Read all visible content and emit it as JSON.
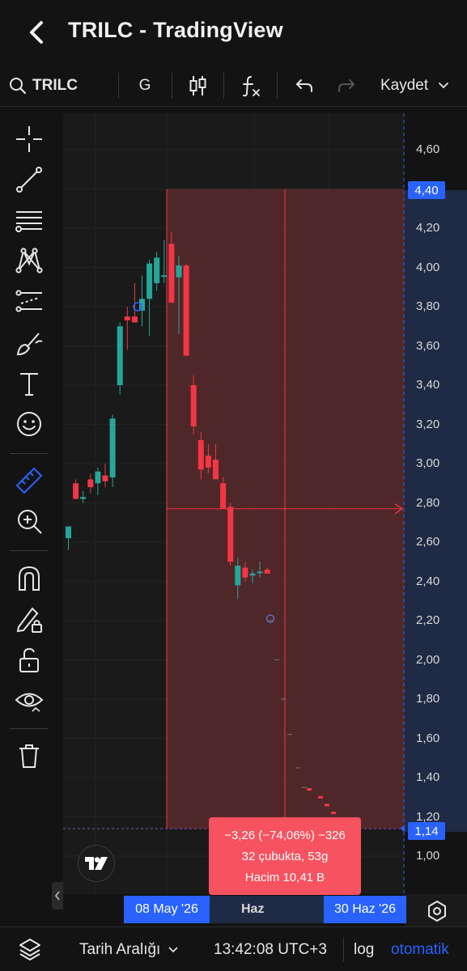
{
  "window": {
    "title": "TRILC - TradingView"
  },
  "toolbar": {
    "symbol": "TRILC",
    "interval": "G",
    "save_label": "Kaydet",
    "icons": [
      "search-icon",
      "candles-icon",
      "indicators-icon",
      "undo-icon",
      "redo-icon",
      "chevron-down-icon"
    ]
  },
  "left_tools": [
    "crosshair-icon",
    "trend-line-icon",
    "fib-icon",
    "pattern-icon",
    "prediction-icon",
    "brush-icon",
    "text-icon",
    "emoji-icon",
    "ruler-icon",
    "zoom-in-icon",
    "magnet-icon",
    "lock-drawings-icon",
    "unlock-icon",
    "eye-icon",
    "trash-icon"
  ],
  "price_scale": {
    "labels": [
      "4,60",
      "4,20",
      "4,00",
      "3,80",
      "3,60",
      "3,40",
      "3,20",
      "3,00",
      "2,80",
      "2,60",
      "2,40",
      "2,20",
      "2,00",
      "1,80",
      "1,60",
      "1,40",
      "1,20",
      "1,00"
    ],
    "top_tag": "4,40",
    "bottom_tag": "1,14"
  },
  "time_scale": {
    "start_tag": "08 May '26",
    "mid_label": "Haz",
    "end_tag": "30 Haz '26"
  },
  "measure_tooltip": {
    "line1": "−3,26 (−74,06%) −326",
    "line2": "32 çubukta, 53g",
    "line3": "Hacim 10,41 B"
  },
  "bottom_bar": {
    "date_range": "Tarih Aralığı",
    "clock": "13:42:08 UTC+3",
    "log": "log",
    "auto": "otomatik"
  },
  "colors": {
    "up": "#26a69a",
    "down": "#f23645",
    "accent": "#2962ff",
    "zone": "#5a2a2c"
  },
  "chart_data": {
    "type": "candlestick",
    "ylim": [
      1.0,
      4.6
    ],
    "candles": [
      {
        "o": 2.62,
        "h": 2.68,
        "l": 2.56,
        "c": 2.68
      },
      {
        "o": 2.9,
        "h": 2.92,
        "l": 2.82,
        "c": 2.82
      },
      {
        "o": 2.82,
        "h": 2.86,
        "l": 2.8,
        "c": 2.83
      },
      {
        "o": 2.92,
        "h": 2.95,
        "l": 2.85,
        "c": 2.88
      },
      {
        "o": 2.9,
        "h": 2.98,
        "l": 2.84,
        "c": 2.96
      },
      {
        "o": 2.94,
        "h": 3.0,
        "l": 2.88,
        "c": 2.91
      },
      {
        "o": 2.93,
        "h": 3.25,
        "l": 2.88,
        "c": 3.23
      },
      {
        "o": 3.4,
        "h": 3.72,
        "l": 3.35,
        "c": 3.7
      },
      {
        "o": 3.75,
        "h": 3.8,
        "l": 3.58,
        "c": 3.73
      },
      {
        "o": 3.75,
        "h": 3.92,
        "l": 3.72,
        "c": 3.72
      },
      {
        "o": 3.78,
        "h": 3.96,
        "l": 3.7,
        "c": 3.84
      },
      {
        "o": 3.84,
        "h": 4.04,
        "l": 3.65,
        "c": 4.02
      },
      {
        "o": 3.92,
        "h": 4.08,
        "l": 3.88,
        "c": 4.05
      },
      {
        "o": 3.96,
        "h": 4.14,
        "l": 3.92,
        "c": 3.96
      },
      {
        "o": 4.12,
        "h": 4.18,
        "l": 3.85,
        "c": 3.82
      },
      {
        "o": 3.95,
        "h": 4.06,
        "l": 3.66,
        "c": 4.01
      },
      {
        "o": 4.01,
        "h": 4.02,
        "l": 3.55,
        "c": 3.55
      },
      {
        "o": 3.4,
        "h": 3.45,
        "l": 3.15,
        "c": 3.19
      },
      {
        "o": 3.12,
        "h": 3.16,
        "l": 2.92,
        "c": 2.97
      },
      {
        "o": 3.04,
        "h": 3.1,
        "l": 2.95,
        "c": 2.98
      },
      {
        "o": 3.02,
        "h": 3.1,
        "l": 2.92,
        "c": 2.92
      },
      {
        "o": 2.9,
        "h": 2.93,
        "l": 2.77,
        "c": 2.77
      },
      {
        "o": 2.78,
        "h": 2.8,
        "l": 2.48,
        "c": 2.5
      },
      {
        "o": 2.38,
        "h": 2.52,
        "l": 2.31,
        "c": 2.48
      },
      {
        "o": 2.47,
        "h": 2.5,
        "l": 2.4,
        "c": 2.42
      },
      {
        "o": 2.43,
        "h": 2.46,
        "l": 2.39,
        "c": 2.44
      },
      {
        "o": 2.45,
        "h": 2.5,
        "l": 2.42,
        "c": 2.45
      },
      {
        "o": 2.46,
        "h": 2.47,
        "l": 2.44,
        "c": 2.44
      }
    ],
    "projected_ticks": [
      2.2,
      2.0,
      1.8,
      1.62,
      1.45,
      1.35,
      1.34,
      1.3,
      1.26,
      1.22
    ],
    "measure": {
      "from": 4.4,
      "to": 1.14,
      "crosshair_price": 2.77
    }
  }
}
